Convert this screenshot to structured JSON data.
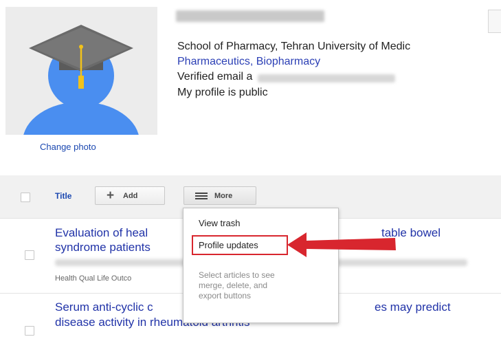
{
  "profile": {
    "change_photo": "Change photo",
    "affiliation": "School of Pharmacy, Tehran University of Medic",
    "interests": "Pharmaceutics, Biopharmacy",
    "verified_email": "Verified email a",
    "visibility": "My profile is public"
  },
  "toolbar": {
    "title_col": "Title",
    "add_label": "Add",
    "more_label": "More"
  },
  "menu": {
    "items": [
      "View trash",
      "Profile updates"
    ],
    "note_lines": [
      "Select articles to see",
      "merge, delete, and",
      "export buttons"
    ]
  },
  "articles": [
    {
      "title_line1": "Evaluation of heal",
      "title_right": "table bowel",
      "title_line2": "syndrome patients",
      "journal": "Health Qual Life Outco"
    },
    {
      "title_line1": "Serum anti-cyclic c",
      "title_right": "es may predict",
      "title_line2": "disease activity in rheumatoid arthritis"
    }
  ],
  "colors": {
    "link": "#2133a8",
    "highlight": "#d8262e",
    "avatar_body": "#4a8ef0",
    "cap": "#6a6a6a",
    "tassel": "#f2c21a"
  }
}
